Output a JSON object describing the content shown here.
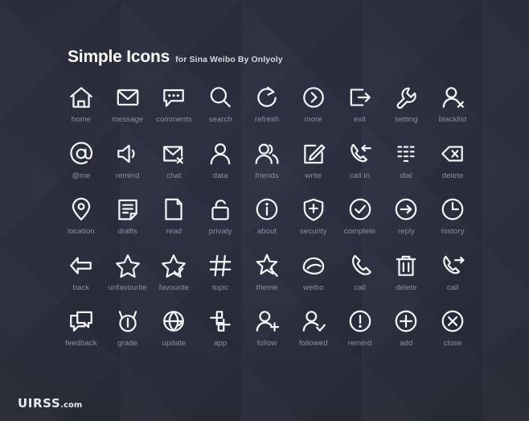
{
  "header": {
    "title": "Simple Icons",
    "subtitle": "for Sina Weibo By Onlyoly"
  },
  "watermark": {
    "name": "UIRSS",
    "tld": ".com"
  },
  "colors": {
    "background": "#282c3a",
    "icon_stroke": "#f4f5f8",
    "label_text": "#8c91a0",
    "title_text": "#fcfcfd"
  },
  "grid": {
    "columns": 9,
    "rows": 5,
    "rows_data": [
      [
        {
          "icon": "home-icon",
          "label": "home"
        },
        {
          "icon": "message-icon",
          "label": "message"
        },
        {
          "icon": "comments-icon",
          "label": "comments"
        },
        {
          "icon": "search-icon",
          "label": "search"
        },
        {
          "icon": "refresh-icon",
          "label": "refresh"
        },
        {
          "icon": "more-icon",
          "label": "more"
        },
        {
          "icon": "exit-icon",
          "label": "exit"
        },
        {
          "icon": "setting-icon",
          "label": "setting"
        },
        {
          "icon": "blacklist-icon",
          "label": "blacklist"
        }
      ],
      [
        {
          "icon": "at-me-icon",
          "label": "@me"
        },
        {
          "icon": "remind-icon",
          "label": "remind"
        },
        {
          "icon": "chat-icon",
          "label": "chat"
        },
        {
          "icon": "data-icon",
          "label": "data"
        },
        {
          "icon": "friends-icon",
          "label": "friends"
        },
        {
          "icon": "write-icon",
          "label": "write"
        },
        {
          "icon": "call-in-icon",
          "label": "call in"
        },
        {
          "icon": "dial-icon",
          "label": "dial"
        },
        {
          "icon": "delete-icon",
          "label": "delete"
        }
      ],
      [
        {
          "icon": "location-icon",
          "label": "location"
        },
        {
          "icon": "drafts-icon",
          "label": "drafts"
        },
        {
          "icon": "read-icon",
          "label": "read"
        },
        {
          "icon": "privacy-icon",
          "label": "privaty"
        },
        {
          "icon": "about-icon",
          "label": "about"
        },
        {
          "icon": "security-icon",
          "label": "security"
        },
        {
          "icon": "complete-icon",
          "label": "complete"
        },
        {
          "icon": "reply-icon",
          "label": "reply"
        },
        {
          "icon": "history-icon",
          "label": "history"
        }
      ],
      [
        {
          "icon": "back-icon",
          "label": "back"
        },
        {
          "icon": "unfavourite-icon",
          "label": "unfavourite"
        },
        {
          "icon": "favourite-icon",
          "label": "favourite"
        },
        {
          "icon": "topic-icon",
          "label": "topic"
        },
        {
          "icon": "theme-icon",
          "label": "theme"
        },
        {
          "icon": "weibo-icon",
          "label": "weibo"
        },
        {
          "icon": "call-icon",
          "label": "call"
        },
        {
          "icon": "trash-delete-icon",
          "label": "delete"
        },
        {
          "icon": "call-out-icon",
          "label": "call"
        }
      ],
      [
        {
          "icon": "feedback-icon",
          "label": "feedback"
        },
        {
          "icon": "grade-icon",
          "label": "grade"
        },
        {
          "icon": "update-icon",
          "label": "update"
        },
        {
          "icon": "app-icon",
          "label": "app"
        },
        {
          "icon": "follow-icon",
          "label": "follow"
        },
        {
          "icon": "followed-icon",
          "label": "followed"
        },
        {
          "icon": "remind-alert-icon",
          "label": "remind"
        },
        {
          "icon": "add-icon",
          "label": "add"
        },
        {
          "icon": "close-icon",
          "label": "close"
        }
      ]
    ]
  }
}
